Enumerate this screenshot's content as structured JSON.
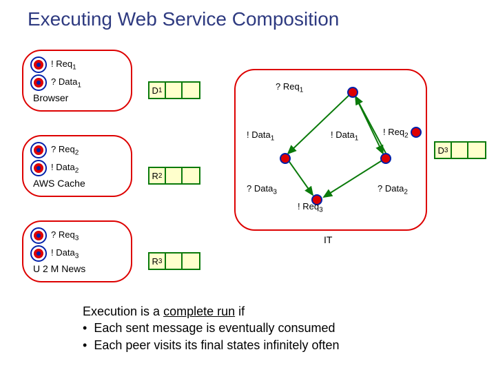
{
  "title": "Executing Web Service Composition",
  "peers": {
    "browser": {
      "name": "Browser",
      "ev1": "! Req",
      "ev1sub": "1",
      "ev2": "? Data",
      "ev2sub": "1"
    },
    "aws": {
      "name": "AWS Cache",
      "ev1": "? Req",
      "ev1sub": "2",
      "ev2": "! Data",
      "ev2sub": "2"
    },
    "u2m": {
      "name": "U 2 M News",
      "ev1": "? Req",
      "ev1sub": "3",
      "ev2": "! Data",
      "ev2sub": "3"
    }
  },
  "queues": {
    "d1": "D",
    "d1sub": "1",
    "r2": "R",
    "r2sub": "2",
    "r3": "R",
    "r3sub": "3",
    "d3": "D",
    "d3sub": "3"
  },
  "it": {
    "label": "IT",
    "nodes": {
      "qreq1": {
        "t": "? Req",
        "s": "1"
      },
      "bdata1a": {
        "t": "! Data",
        "s": "1"
      },
      "bdata1b": {
        "t": "! Data",
        "s": "1"
      },
      "breq2": {
        "t": "! Req",
        "s": "2"
      },
      "qdata3": {
        "t": "? Data",
        "s": "3"
      },
      "qdata2": {
        "t": "? Data",
        "s": "2"
      },
      "breq3": {
        "t": "! Req",
        "s": "3"
      }
    }
  },
  "footer": {
    "line1a": "Execution is  a ",
    "line1b": "complete run",
    "line1c": " if",
    "b1": "Each sent message is eventually consumed",
    "b2": "Each peer visits its final states infinitely often"
  }
}
